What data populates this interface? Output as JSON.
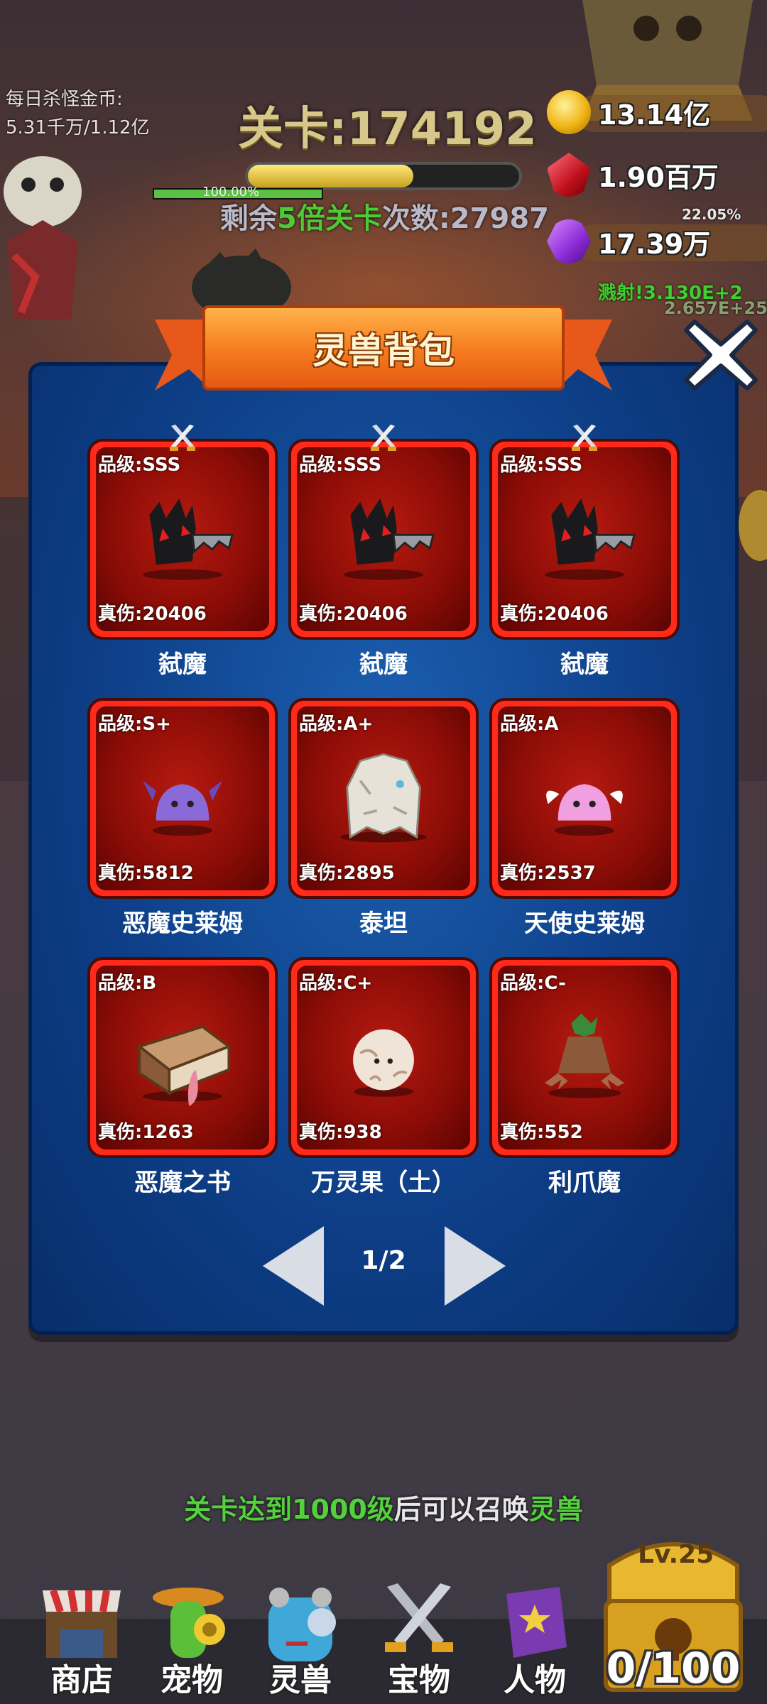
{
  "hud": {
    "daily_kill_label": "每日杀怪金币:",
    "daily_kill_value": "5.31千万/1.12亿",
    "stage": "关卡:174192",
    "boss_hp_pct": "100.00%",
    "remain_prefix": "剩余",
    "remain_highlight": "5倍关卡",
    "remain_suffix": "次数:27987",
    "stage_progress": 0.61,
    "boss_hp_fraction": 1.0,
    "resources": [
      {
        "icon": "gold-coin-icon",
        "value": "13.14亿"
      },
      {
        "icon": "ruby-icon",
        "value": "1.90百万"
      },
      {
        "icon": "purple-gem-icon",
        "value": "17.39万"
      }
    ],
    "float_texts": [
      "溅射!3.130E+2",
      "2.657E+25",
      "22.05%"
    ]
  },
  "panel": {
    "title": "灵兽背包",
    "close_icon": "close-x-icon",
    "cards": [
      {
        "grade": "品级:SSS",
        "damage": "真伤:20406",
        "name": "弑魔",
        "equipped": true,
        "art": "demon-slayer"
      },
      {
        "grade": "品级:SSS",
        "damage": "真伤:20406",
        "name": "弑魔",
        "equipped": true,
        "art": "demon-slayer"
      },
      {
        "grade": "品级:SSS",
        "damage": "真伤:20406",
        "name": "弑魔",
        "equipped": true,
        "art": "demon-slayer"
      },
      {
        "grade": "品级:S+",
        "damage": "真伤:5812",
        "name": "恶魔史莱姆",
        "equipped": false,
        "art": "devil-slime"
      },
      {
        "grade": "品级:A+",
        "damage": "真伤:2895",
        "name": "泰坦",
        "equipped": false,
        "art": "titan"
      },
      {
        "grade": "品级:A",
        "damage": "真伤:2537",
        "name": "天使史莱姆",
        "equipped": false,
        "art": "angel-slime"
      },
      {
        "grade": "品级:B",
        "damage": "真伤:1263",
        "name": "恶魔之书",
        "equipped": false,
        "art": "demon-book"
      },
      {
        "grade": "品级:C+",
        "damage": "真伤:938",
        "name": "万灵果（土）",
        "equipped": false,
        "art": "spirit-fruit"
      },
      {
        "grade": "品级:C-",
        "damage": "真伤:552",
        "name": "利爪魔",
        "equipped": false,
        "art": "claw-demon"
      }
    ],
    "page": "1/2"
  },
  "hint": {
    "part1": "关卡达到",
    "part2": "1000级",
    "part3": "后可以召唤",
    "part4": "灵兽"
  },
  "nav": [
    {
      "label": "商店",
      "icon": "shop-icon"
    },
    {
      "label": "宠物",
      "icon": "pet-icon"
    },
    {
      "label": "灵兽",
      "icon": "spirit-beast-icon"
    },
    {
      "label": "宝物",
      "icon": "treasure-swords-icon"
    },
    {
      "label": "人物",
      "icon": "character-book-icon"
    }
  ],
  "chest": {
    "level": "Lv.25",
    "count": "0/100"
  },
  "colors": {
    "accent_green": "#53d13b",
    "card_red": "#ff2a1a",
    "panel_blue": "#1b5fb0",
    "banner_orange": "#f57a1e"
  }
}
